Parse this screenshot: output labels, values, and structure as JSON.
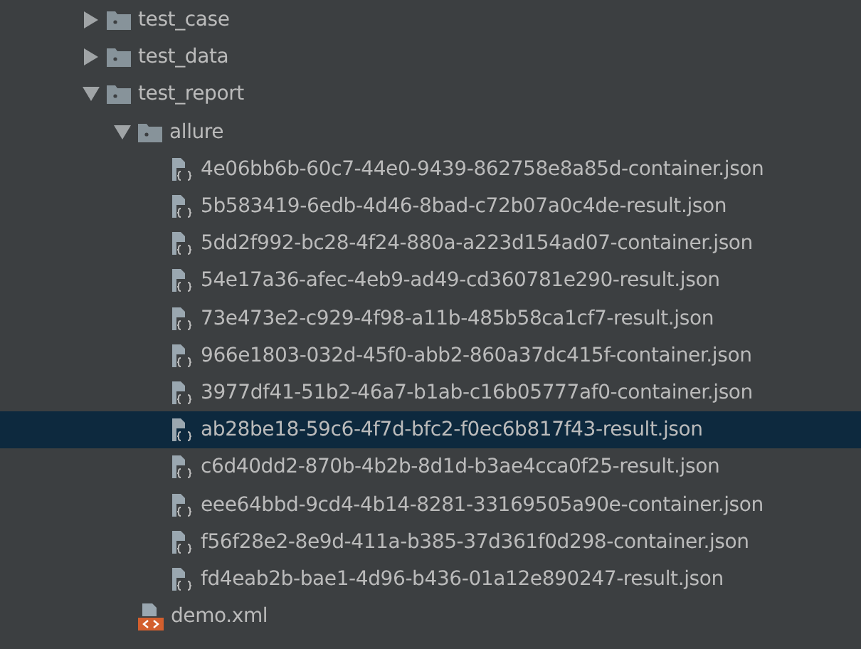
{
  "tree": [
    {
      "kind": "folder",
      "label": "test_case",
      "expanded": false,
      "selected": false
    },
    {
      "kind": "folder",
      "label": "test_data",
      "expanded": false,
      "selected": false
    },
    {
      "kind": "folder",
      "label": "test_report",
      "expanded": true,
      "selected": false,
      "children": [
        {
          "kind": "folder",
          "label": "allure",
          "expanded": true,
          "selected": false,
          "children": [
            {
              "kind": "json",
              "label": "4e06bb6b-60c7-44e0-9439-862758e8a85d-container.json",
              "selected": false
            },
            {
              "kind": "json",
              "label": "5b583419-6edb-4d46-8bad-c72b07a0c4de-result.json",
              "selected": false
            },
            {
              "kind": "json",
              "label": "5dd2f992-bc28-4f24-880a-a223d154ad07-container.json",
              "selected": false
            },
            {
              "kind": "json",
              "label": "54e17a36-afec-4eb9-ad49-cd360781e290-result.json",
              "selected": false
            },
            {
              "kind": "json",
              "label": "73e473e2-c929-4f98-a11b-485b58ca1cf7-result.json",
              "selected": false
            },
            {
              "kind": "json",
              "label": "966e1803-032d-45f0-abb2-860a37dc415f-container.json",
              "selected": false
            },
            {
              "kind": "json",
              "label": "3977df41-51b2-46a7-b1ab-c16b05777af0-container.json",
              "selected": false
            },
            {
              "kind": "json",
              "label": "ab28be18-59c6-4f7d-bfc2-f0ec6b817f43-result.json",
              "selected": true
            },
            {
              "kind": "json",
              "label": "c6d40dd2-870b-4b2b-8d1d-b3ae4cca0f25-result.json",
              "selected": false
            },
            {
              "kind": "json",
              "label": "eee64bbd-9cd4-4b14-8281-33169505a90e-container.json",
              "selected": false
            },
            {
              "kind": "json",
              "label": "f56f28e2-8e9d-411a-b385-37d361f0d298-container.json",
              "selected": false
            },
            {
              "kind": "json",
              "label": "fd4eab2b-bae1-4d96-b436-01a12e890247-result.json",
              "selected": false
            }
          ]
        },
        {
          "kind": "xml",
          "label": "demo.xml",
          "selected": false
        }
      ]
    }
  ]
}
